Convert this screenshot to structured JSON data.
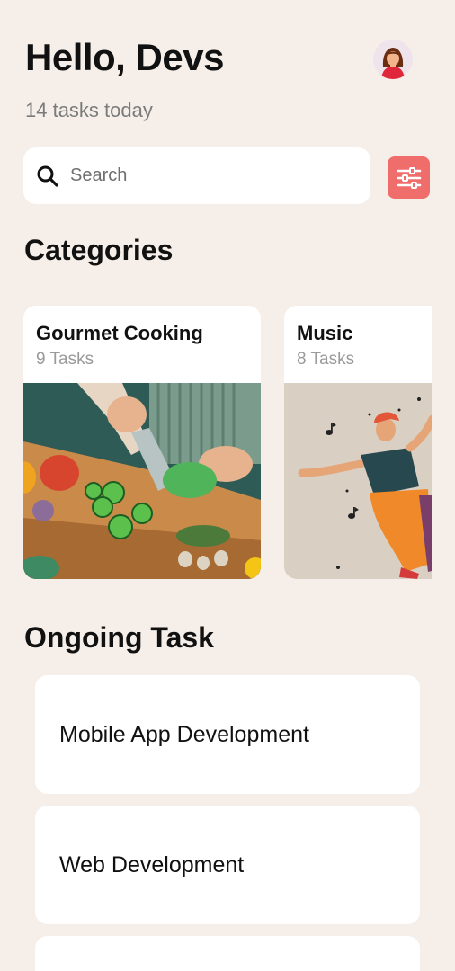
{
  "header": {
    "greeting": "Hello, Devs",
    "subtitle": "14 tasks today",
    "avatar_icon": "woman-avatar-icon"
  },
  "search": {
    "placeholder": "Search",
    "value": "",
    "icon": "search-icon"
  },
  "filter": {
    "icon": "sliders-icon",
    "color": "#ef6d6a"
  },
  "categories": {
    "title": "Categories",
    "items": [
      {
        "name": "Gourmet Cooking",
        "count": "9 Tasks",
        "image": "cooking-illustration"
      },
      {
        "name": "Music",
        "count": "8 Tasks",
        "image": "dancing-illustration"
      }
    ]
  },
  "ongoing": {
    "title": "Ongoing Task",
    "items": [
      {
        "title": "Mobile App Development"
      },
      {
        "title": "Web Development"
      },
      {
        "title": ""
      }
    ]
  },
  "colors": {
    "background": "#f6efe9",
    "card": "#ffffff",
    "accent": "#ef6d6a"
  }
}
